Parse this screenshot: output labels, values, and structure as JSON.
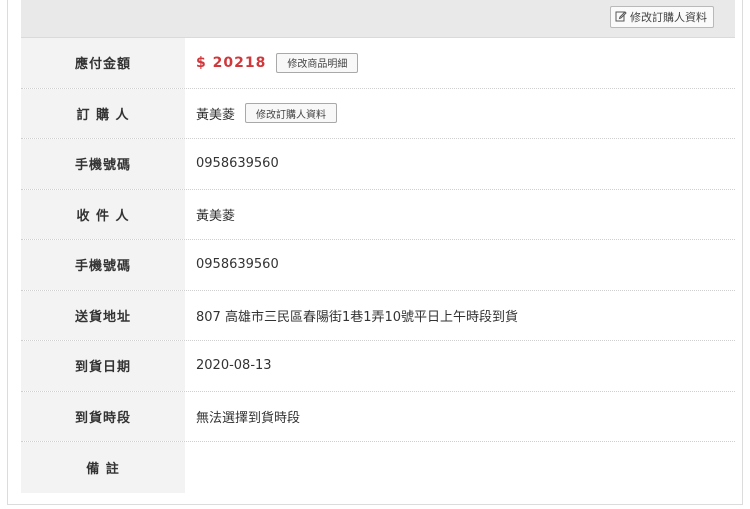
{
  "top": {
    "edit_buyer_button": "修改訂購人資料",
    "edit_icon": "edit-icon"
  },
  "rows": [
    {
      "label": "應付金額",
      "value": "$ 20218",
      "button": "修改商品明細"
    },
    {
      "label": "訂 購 人",
      "value": "黃美菱",
      "button": "修改訂購人資料"
    },
    {
      "label": "手機號碼",
      "value": "0958639560"
    },
    {
      "label": "收 件 人",
      "value": "黃美菱"
    },
    {
      "label": "手機號碼",
      "value": "0958639560"
    },
    {
      "label": "送貨地址",
      "value": "807 高雄市三民區春陽街1巷1弄10號平日上午時段到貨"
    },
    {
      "label": "到貨日期",
      "value": "2020-08-13"
    },
    {
      "label": "到貨時段",
      "value": "無法選擇到貨時段"
    },
    {
      "label": "備 註",
      "value": ""
    }
  ],
  "colors": {
    "amount": "#d0383b",
    "label_bg": "#f3f3f3",
    "header_bg": "#e9e9e9"
  }
}
